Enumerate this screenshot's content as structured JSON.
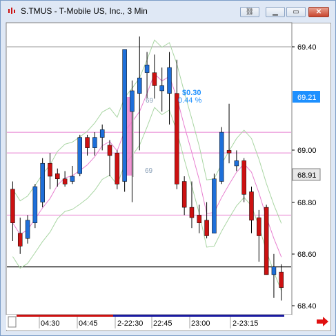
{
  "window": {
    "title": "S.TMUS - T-Mobile US, Inc., 3 Min",
    "buttons": [
      "link-icon",
      "minimize-icon",
      "maximize-icon",
      "close-icon"
    ]
  },
  "annotation": {
    "price_change": "$0.30",
    "percent_change": "0.44 %",
    "bar_count_top": "69",
    "bar_count_bottom": "69"
  },
  "price_axis": {
    "ticks": [
      "69.40",
      "69.00",
      "68.80",
      "68.60",
      "68.40"
    ],
    "markers": [
      {
        "label": "69.21",
        "bg": "#1e90ff",
        "fg": "#ffffff"
      },
      {
        "label": "68.91",
        "bg": "#e8e8e8",
        "fg": "#000000"
      }
    ]
  },
  "time_axis": {
    "labels": [
      "04:30",
      "04:45",
      "2-22:30",
      "22:45",
      "23:00",
      "2-23:15"
    ]
  },
  "chart_data": {
    "type": "candlestick",
    "y_range": [
      68.35,
      69.5
    ],
    "colors": {
      "up": "#1e6fd9",
      "down": "#cc1111",
      "band": "#a8d5a2",
      "pink": "#e87fd0"
    },
    "reference_lines": [
      {
        "y": 69.4,
        "color": "#999999"
      },
      {
        "y": 69.07,
        "color": "#e87fd0"
      },
      {
        "y": 68.99,
        "color": "#e87fd0"
      },
      {
        "y": 68.75,
        "color": "#e87fd0"
      },
      {
        "y": 68.55,
        "color": "#000000"
      }
    ],
    "candles": [
      {
        "o": 68.85,
        "h": 68.88,
        "c": 68.72,
        "l": 68.65
      },
      {
        "o": 68.68,
        "h": 68.74,
        "c": 68.63,
        "l": 68.6
      },
      {
        "o": 68.66,
        "h": 68.75,
        "c": 68.73,
        "l": 68.64
      },
      {
        "o": 68.72,
        "h": 68.87,
        "c": 68.86,
        "l": 68.7
      },
      {
        "o": 68.8,
        "h": 68.97,
        "c": 68.95,
        "l": 68.78
      },
      {
        "o": 68.95,
        "h": 68.99,
        "c": 68.9,
        "l": 68.85
      },
      {
        "o": 68.91,
        "h": 68.93,
        "c": 68.89,
        "l": 68.86
      },
      {
        "o": 68.89,
        "h": 68.92,
        "c": 68.87,
        "l": 68.86
      },
      {
        "o": 68.88,
        "h": 68.94,
        "c": 68.9,
        "l": 68.87
      },
      {
        "o": 68.91,
        "h": 69.06,
        "c": 69.05,
        "l": 68.9
      },
      {
        "o": 69.05,
        "h": 69.06,
        "c": 69.01,
        "l": 68.98
      },
      {
        "o": 69.01,
        "h": 69.07,
        "c": 69.05,
        "l": 68.98
      },
      {
        "o": 69.05,
        "h": 69.1,
        "c": 69.08,
        "l": 69.0
      },
      {
        "o": 69.02,
        "h": 69.04,
        "c": 68.98,
        "l": 68.9
      },
      {
        "o": 68.99,
        "h": 69.0,
        "c": 68.87,
        "l": 68.85
      },
      {
        "o": 68.88,
        "h": 69.39,
        "c": 69.39,
        "l": 68.84
      },
      {
        "o": 69.15,
        "h": 69.27,
        "c": 69.23,
        "l": 68.8
      },
      {
        "o": 69.22,
        "h": 69.44,
        "c": 69.28,
        "l": 69.0
      },
      {
        "o": 69.3,
        "h": 69.38,
        "c": 69.33,
        "l": 69.2
      },
      {
        "o": 69.3,
        "h": 69.37,
        "c": 69.25,
        "l": 69.2
      },
      {
        "o": 69.23,
        "h": 69.32,
        "c": 69.25,
        "l": 69.15
      },
      {
        "o": 69.22,
        "h": 69.38,
        "c": 69.32,
        "l": 69.1
      },
      {
        "o": 69.22,
        "h": 69.35,
        "c": 68.87,
        "l": 68.85
      },
      {
        "o": 68.88,
        "h": 68.9,
        "c": 68.78,
        "l": 68.75
      },
      {
        "o": 68.78,
        "h": 68.88,
        "c": 68.74,
        "l": 68.7
      },
      {
        "o": 68.75,
        "h": 68.79,
        "c": 68.72,
        "l": 68.68
      },
      {
        "o": 68.73,
        "h": 68.8,
        "c": 68.67,
        "l": 68.66
      },
      {
        "o": 68.68,
        "h": 68.91,
        "c": 68.89,
        "l": 68.68
      },
      {
        "o": 68.88,
        "h": 69.09,
        "c": 69.07,
        "l": 68.87
      },
      {
        "o": 69.0,
        "h": 69.18,
        "c": 68.99,
        "l": 68.95
      },
      {
        "o": 68.94,
        "h": 69.0,
        "c": 68.96,
        "l": 68.92
      },
      {
        "o": 68.96,
        "h": 68.97,
        "c": 68.83,
        "l": 68.8
      },
      {
        "o": 68.84,
        "h": 68.86,
        "c": 68.73,
        "l": 68.68
      },
      {
        "o": 68.74,
        "h": 68.77,
        "c": 68.67,
        "l": 68.57
      },
      {
        "o": 68.78,
        "h": 68.79,
        "c": 68.52,
        "l": 68.52
      },
      {
        "o": 68.52,
        "h": 68.6,
        "c": 68.55,
        "l": 68.43
      },
      {
        "o": 68.53,
        "h": 68.56,
        "c": 68.47,
        "l": 68.42
      }
    ]
  }
}
